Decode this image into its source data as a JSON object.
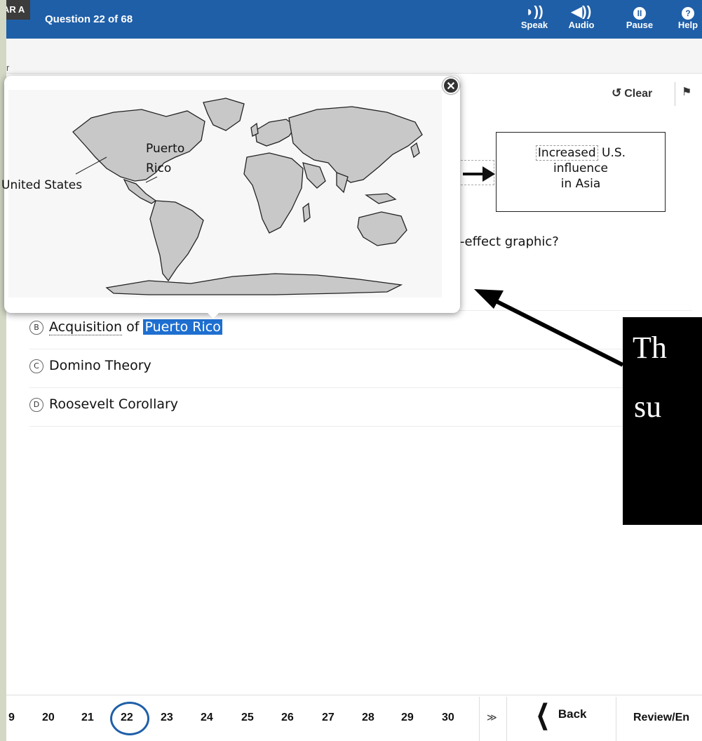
{
  "header": {
    "test_code": "AR A",
    "question_counter": "Question 22 of 68",
    "tools": [
      {
        "label": "Speak",
        "icon": "speak-icon",
        "glyph": "◗))"
      },
      {
        "label": "Audio",
        "icon": "audio-icon",
        "glyph": "◀))"
      },
      {
        "label": "Pause",
        "icon": "pause-icon",
        "glyph": "II"
      },
      {
        "label": "Help",
        "icon": "help-icon",
        "glyph": "?"
      }
    ]
  },
  "subbar": {
    "label": "r"
  },
  "item_tools": {
    "clear_label": "Clear",
    "clear_glyph": "↺",
    "flag_glyph": "⚑"
  },
  "graphic": {
    "effect_line1_hl": "Increased",
    "effect_line1_rest": " U.S.",
    "effect_line2": "influence",
    "effect_line3": "in Asia"
  },
  "question": {
    "visible_text": "-effect graphic?"
  },
  "options": [
    {
      "letter": "B",
      "text_plain": "Acquisition",
      "text_mid": " of ",
      "text_hilite": "Puerto Rico"
    },
    {
      "letter": "C",
      "text": "Domino Theory"
    },
    {
      "letter": "D",
      "text": "Roosevelt Corollary"
    }
  ],
  "map_popup": {
    "close_glyph": "✕",
    "labels": {
      "puerto_rico_1": "Puerto",
      "puerto_rico_2": "Rico",
      "united_states": "United States"
    },
    "land_color": "#c8c8c8"
  },
  "annotation": {
    "line1": "Th",
    "line2": "su"
  },
  "bottom_nav": {
    "numbers": [
      "9",
      "20",
      "21",
      "22",
      "23",
      "24",
      "25",
      "26",
      "27",
      "28",
      "29",
      "30"
    ],
    "current": "22",
    "back_label": "Back",
    "back_glyph": "❮",
    "next_glyph": "≫",
    "review_label": "Review/En"
  },
  "colors": {
    "header_blue": "#1f5fa8",
    "highlight_blue": "#1e6fd0",
    "margin": "#d3d8c5"
  }
}
